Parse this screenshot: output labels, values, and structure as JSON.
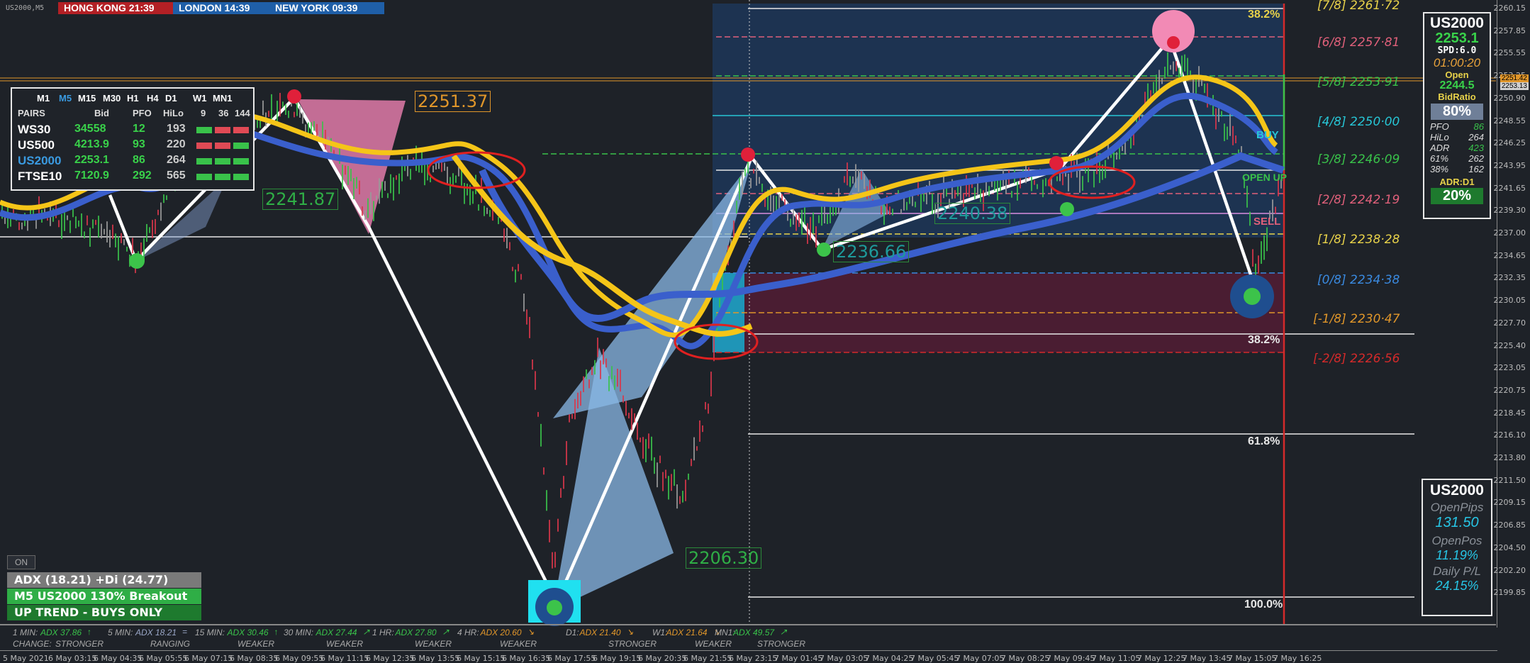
{
  "window": {
    "symbol_tf": "US2000,M5"
  },
  "sessions": [
    {
      "label": "HONG KONG 21:39",
      "color": "#b32025"
    },
    {
      "label": "LONDON  14:39",
      "color": "#1f5fa8"
    },
    {
      "label": "NEW YORK  09:39",
      "color": "#1f5fa8"
    }
  ],
  "dashboard": {
    "timeframes": [
      "M1",
      "M5",
      "M15",
      "M30",
      "H1",
      "H4",
      "D1",
      "W1",
      "MN1"
    ],
    "active_tf": "M5",
    "headers": [
      "PAIRS",
      "Bid",
      "PFO",
      "HiLo",
      "9",
      "36",
      "144"
    ],
    "rows": [
      {
        "pair": "WS30",
        "bid": "34558",
        "pfo": "12",
        "hilo": "193",
        "bars": [
          "green",
          "red",
          "red"
        ]
      },
      {
        "pair": "US500",
        "bid": "4213.9",
        "pfo": "93",
        "hilo": "220",
        "bars": [
          "red",
          "red",
          "green"
        ]
      },
      {
        "pair": "US2000",
        "bid": "2253.1",
        "pfo": "86",
        "hilo": "264",
        "bars": [
          "green",
          "green",
          "green"
        ]
      },
      {
        "pair": "FTSE10",
        "bid": "7120.9",
        "pfo": "292",
        "hilo": "565",
        "bars": [
          "green",
          "green",
          "green"
        ]
      }
    ]
  },
  "chart_labels": {
    "p2251": "2251.37",
    "p2241": "2241.87",
    "p2240": "2240.38",
    "p2236": "2236.66",
    "p2206": "2206.30",
    "fib_top": "38.2%",
    "fib_mid": "38.2%",
    "fib_618": "61.8%",
    "fib_100": "100.0%",
    "buy": "BUY",
    "open_up": "OPEN UP",
    "sell": "SELL"
  },
  "murrey_levels": [
    {
      "label": "[7/8]  2261·72",
      "color": "#e8d24a"
    },
    {
      "label": "[6/8]  2257·81",
      "color": "#e0607a"
    },
    {
      "label": "[5/8]  2253·91",
      "color": "#39c24a"
    },
    {
      "label": "[4/8]  2250·00",
      "color": "#27c6d6"
    },
    {
      "label": "[3/8]  2246·09",
      "color": "#39c24a"
    },
    {
      "label": "[2/8]  2242·19",
      "color": "#e0607a"
    },
    {
      "label": "[1/8]  2238·28",
      "color": "#e8d24a"
    },
    {
      "label": "[0/8]  2234·38",
      "color": "#3a8ae0"
    },
    {
      "label": "[-1/8]  2230·47",
      "color": "#e0962a"
    },
    {
      "label": "[-2/8]  2226·56",
      "color": "#d42a2a"
    }
  ],
  "info_panel": {
    "symbol": "US2000",
    "price": "2253.1",
    "spread": "SPD:6.0",
    "countdown": "01:00:20",
    "open_label": "Open",
    "open_value": "2244.5",
    "bid_ratio_label": "BidRatio",
    "bid_ratio_value": "80%",
    "stats": [
      {
        "k": "PFO",
        "v": "86"
      },
      {
        "k": "HiLo",
        "v": "264"
      },
      {
        "k": "ADR",
        "v": "423"
      },
      {
        "k": "61%",
        "v": "262"
      },
      {
        "k": "38%",
        "v": "162"
      }
    ],
    "adr_label": "ADR:D1",
    "adr_value": "20%"
  },
  "pips_panel": {
    "symbol": "US2000",
    "open_pips_label": "OpenPips",
    "open_pips": "131.50",
    "open_pos_label": "OpenPos",
    "open_pos": "11.19%",
    "daily_pl_label": "Daily P/L",
    "daily_pl": "24.15%"
  },
  "status_boxes": {
    "on_button": "ON",
    "adx": "ADX (18.21)    +Di (24.77)",
    "breakout": "M5 US2000 130% Breakout",
    "trend": "UP TREND - BUYS ONLY"
  },
  "adx_bar": {
    "change_label": "CHANGE:",
    "items": [
      {
        "tf": "1 MIN:",
        "adx": "ADX 37.86",
        "arrow": "↑",
        "state": "STRONGER",
        "color": "#39c24a"
      },
      {
        "tf": "5 MIN:",
        "adx": "ADX 18.21",
        "arrow": "=",
        "state": "RANGING",
        "color": "#9aa7c7"
      },
      {
        "tf": "15 MIN:",
        "adx": "ADX 30.46",
        "arrow": "↑",
        "state": "WEAKER",
        "color": "#39c24a"
      },
      {
        "tf": "30 MIN:",
        "adx": "ADX 27.44",
        "arrow": "↗",
        "state": "WEAKER",
        "color": "#39c24a"
      },
      {
        "tf": "1 HR:",
        "adx": "ADX 27.80",
        "arrow": "↗",
        "state": "WEAKER",
        "color": "#39c24a"
      },
      {
        "tf": "4 HR:",
        "adx": "ADX 20.60",
        "arrow": "↘",
        "state": "WEAKER",
        "color": "#e0962a"
      },
      {
        "tf": "D1:",
        "adx": "ADX 21.40",
        "arrow": "↘",
        "state": "STRONGER",
        "color": "#e0962a"
      },
      {
        "tf": "W1:",
        "adx": "ADX 21.64",
        "arrow": "↘",
        "state": "WEAKER",
        "color": "#e0962a"
      },
      {
        "tf": "MN1:",
        "adx": "ADX 49.57",
        "arrow": "↗",
        "state": "STRONGER",
        "color": "#39c24a"
      }
    ]
  },
  "price_axis": [
    "2260.15",
    "2257.85",
    "2255.55",
    "2253.25",
    "2250.90",
    "2248.55",
    "2246.25",
    "2243.95",
    "2241.65",
    "2239.30",
    "2237.00",
    "2234.65",
    "2232.35",
    "2230.05",
    "2227.70",
    "2225.40",
    "2223.05",
    "2220.75",
    "2218.45",
    "2216.10",
    "2213.80",
    "2211.50",
    "2209.15",
    "2206.85",
    "2204.50",
    "2202.20",
    "2199.85"
  ],
  "current_prices": [
    "2251.42",
    "2253.13"
  ],
  "time_axis": [
    "5 May 2021",
    "6 May 03:15",
    "6 May 04:35",
    "6 May 05:55",
    "6 May 07:15",
    "6 May 08:35",
    "6 May 09:55",
    "6 May 11:15",
    "6 May 12:35",
    "6 May 13:55",
    "6 May 15:15",
    "6 May 16:35",
    "6 May 17:55",
    "6 May 19:15",
    "6 May 20:35",
    "6 May 21:55",
    "6 May 23:15",
    "7 May 01:45",
    "7 May 03:05",
    "7 May 04:25",
    "7 May 05:45",
    "7 May 07:05",
    "7 May 08:25",
    "7 May 09:45",
    "7 May 11:05",
    "7 May 12:25",
    "7 May 13:45",
    "7 May 15:05",
    "7 May 16:25"
  ],
  "colors": {
    "background": "#1e2228",
    "bull": "#39c24a",
    "bear": "#d9364a",
    "ma_fast": "#f5c518",
    "ma_slow": "#3a5fcc"
  }
}
